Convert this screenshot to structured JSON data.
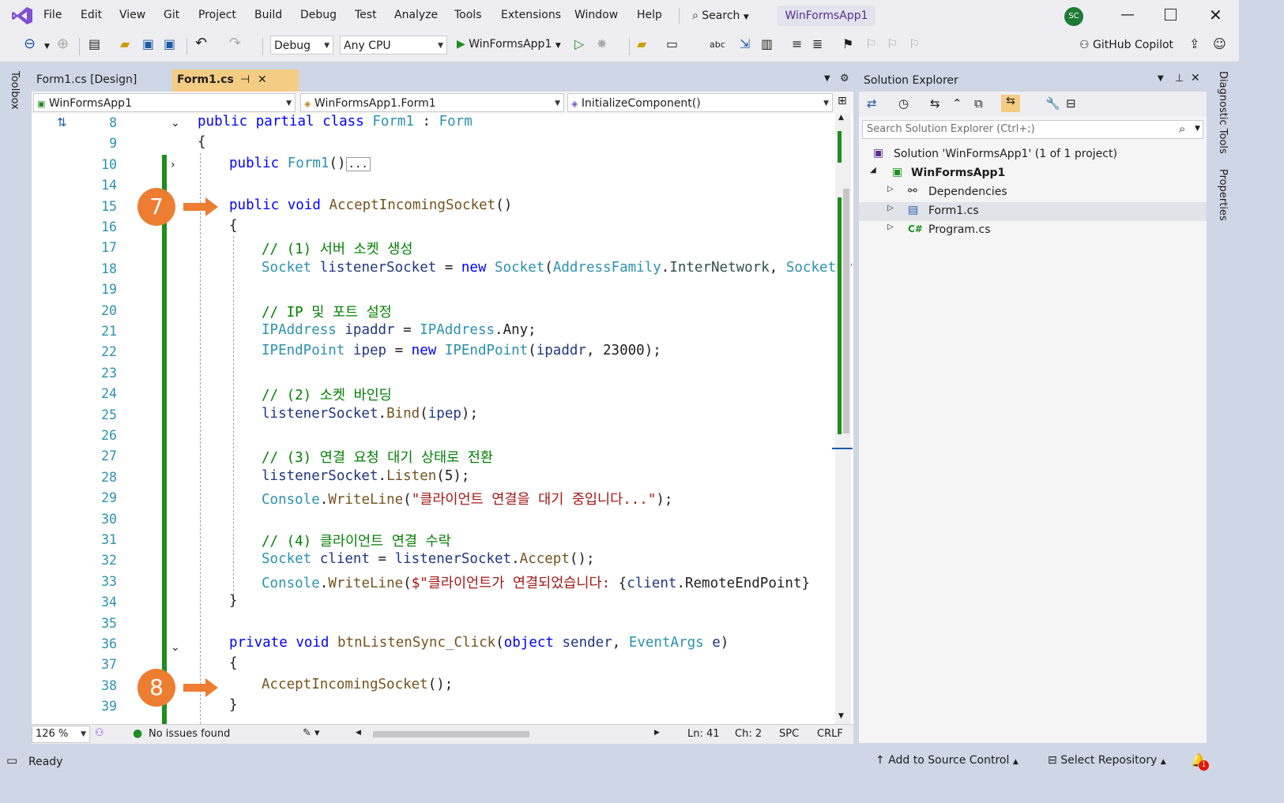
{
  "menu": [
    "File",
    "Edit",
    "View",
    "Git",
    "Project",
    "Build",
    "Debug",
    "Test",
    "Analyze",
    "Tools",
    "Extensions",
    "Window",
    "Help"
  ],
  "search_label": "Search",
  "solution_title": "WinFormsApp1",
  "avatar_initials": "SC",
  "toolbar": {
    "config": "Debug",
    "platform": "Any CPU",
    "start_target": "WinFormsApp1",
    "copilot": "GitHub Copilot"
  },
  "tabs": [
    {
      "label": "Form1.cs [Design]",
      "active": false
    },
    {
      "label": "Form1.cs",
      "active": true
    }
  ],
  "nav": {
    "project": "WinFormsApp1",
    "class": "WinFormsApp1.Form1",
    "member": "InitializeComponent()"
  },
  "left_strip_label": "Toolbox",
  "right_strip_labels": [
    "Diagnostic Tools",
    "Properties"
  ],
  "callouts": [
    "7",
    "8"
  ],
  "code": [
    {
      "ln": "8",
      "indent": 0,
      "html": "<span class='kw'>public</span> <span class='kw'>partial</span> <span class='kw'>class</span> <span class='ty'>Form1</span> : <span class='ty'>Form</span>"
    },
    {
      "ln": "9",
      "indent": 0,
      "html": "{"
    },
    {
      "ln": "10",
      "indent": 1,
      "html": "<span class='kw'>public</span> <span class='ty'>Form1</span>()<span style='border:1px solid #999;font-size:14px;padding:0 2px'>...</span>"
    },
    {
      "ln": "14",
      "indent": 0,
      "html": ""
    },
    {
      "ln": "15",
      "indent": 1,
      "html": "<span class='kw'>public</span> <span class='kw'>void</span> <span class='fn'>AcceptIncomingSocket</span>()"
    },
    {
      "ln": "16",
      "indent": 1,
      "html": "{"
    },
    {
      "ln": "17",
      "indent": 2,
      "html": "<span class='cm'>// (1) 서버 소켓 생성</span>"
    },
    {
      "ln": "18",
      "indent": 2,
      "html": "<span class='ty'>Socket</span> <span class='pm'>listenerSocket</span> = <span class='kw'>new</span> <span class='ty'>Socket</span>(<span class='ty'>AddressFamily</span>.<span class='en'>InterNetwork</span>, <span class='ty'>SocketTyp</span>"
    },
    {
      "ln": "19",
      "indent": 0,
      "html": ""
    },
    {
      "ln": "20",
      "indent": 2,
      "html": "<span class='cm'>// IP 및 포트 설정</span>"
    },
    {
      "ln": "21",
      "indent": 2,
      "html": "<span class='ty'>IPAddress</span> <span class='pm'>ipaddr</span> = <span class='ty'>IPAddress</span>.Any;"
    },
    {
      "ln": "22",
      "indent": 2,
      "html": "<span class='ty'>IPEndPoint</span> <span class='pm'>ipep</span> = <span class='kw'>new</span> <span class='ty'>IPEndPoint</span>(<span class='pm'>ipaddr</span>, 23000);"
    },
    {
      "ln": "23",
      "indent": 0,
      "html": ""
    },
    {
      "ln": "24",
      "indent": 2,
      "html": "<span class='cm'>// (2) 소켓 바인딩</span>"
    },
    {
      "ln": "25",
      "indent": 2,
      "html": "<span class='pm'>listenerSocket</span>.<span class='fn'>Bind</span>(<span class='pm'>ipep</span>);"
    },
    {
      "ln": "26",
      "indent": 0,
      "html": ""
    },
    {
      "ln": "27",
      "indent": 2,
      "html": "<span class='cm'>// (3) 연결 요청 대기 상태로 전환</span>"
    },
    {
      "ln": "28",
      "indent": 2,
      "html": "<span class='pm'>listenerSocket</span>.<span class='fn'>Listen</span>(5);"
    },
    {
      "ln": "29",
      "indent": 2,
      "html": "<span class='ty'>Console</span>.<span class='fn'>WriteLine</span>(<span class='st'>\"클라이언트 연결을 대기 중입니다...\"</span>);"
    },
    {
      "ln": "30",
      "indent": 0,
      "html": ""
    },
    {
      "ln": "31",
      "indent": 2,
      "html": "<span class='cm'>// (4) 클라이언트 연결 수락</span>"
    },
    {
      "ln": "32",
      "indent": 2,
      "html": "<span class='ty'>Socket</span> <span class='pm'>client</span> = <span class='pm'>listenerSocket</span>.<span class='fn'>Accept</span>();"
    },
    {
      "ln": "33",
      "indent": 2,
      "html": "<span class='ty'>Console</span>.<span class='fn'>WriteLine</span>(<span class='st'>$\"클라이언트가 연결되었습니다: </span>{<span class='pm'>client</span>.RemoteEndPoint}"
    },
    {
      "ln": "34",
      "indent": 1,
      "html": "}"
    },
    {
      "ln": "35",
      "indent": 0,
      "html": ""
    },
    {
      "ln": "36",
      "indent": 1,
      "html": "<span class='kw'>private</span> <span class='kw'>void</span> <span class='fn'>btnListenSync_Click</span>(<span class='kw'>object</span> <span class='pm'>sender</span>, <span class='ty'>EventArgs</span> <span class='pm'>e</span>)"
    },
    {
      "ln": "37",
      "indent": 1,
      "html": "{"
    },
    {
      "ln": "38",
      "indent": 2,
      "html": "<span class='fn'>AcceptIncomingSocket</span>();"
    },
    {
      "ln": "39",
      "indent": 1,
      "html": "}"
    }
  ],
  "editor_status": {
    "zoom": "126 %",
    "issues": "No issues found",
    "ln": "Ln: 41",
    "ch": "Ch: 2",
    "spc": "SPC",
    "crlf": "CRLF"
  },
  "solution_explorer": {
    "title": "Solution Explorer",
    "search_placeholder": "Search Solution Explorer (Ctrl+;)",
    "items": [
      {
        "label": "Solution 'WinFormsApp1' (1 of 1 project)",
        "bold": false
      },
      {
        "label": "WinFormsApp1",
        "bold": true
      },
      {
        "label": "Dependencies",
        "bold": false
      },
      {
        "label": "Form1.cs",
        "bold": false
      },
      {
        "label": "Program.cs",
        "bold": false
      }
    ]
  },
  "statusbar": {
    "ready": "Ready",
    "add_source": "Add to Source Control",
    "select_repo": "Select Repository",
    "notif_count": "1"
  }
}
